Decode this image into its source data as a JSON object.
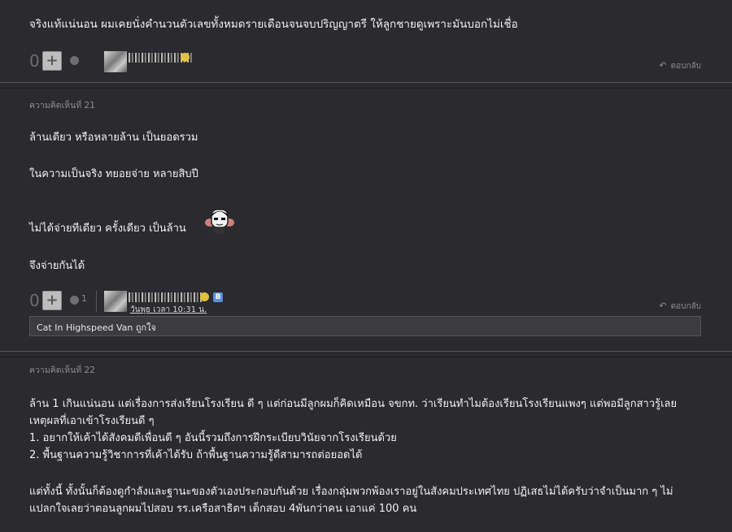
{
  "comment20": {
    "text": "จริงแท้แน่นอน   ผมเคยนั่งคำนวนตัวเลขทั้งหมดรายเดือนจนจบปริญญาตรี   ให้ลูกชายดูเพราะมันบอกไม่เชื่อ",
    "score": "0",
    "plus_label": "+",
    "reply_label": "ตอบกลับ"
  },
  "comment21": {
    "label": "ความคิดเห็นที่ 21",
    "lines": [
      "ล้านเดียว หรือหลายล้าน  เป็นยอดรวม",
      "ในความเป็นจริง ทยอยจ่าย  หลายสิบปี",
      "ไม่ได้จ่ายทีเดียว  ครั้งเดียว  เป็นล้าน",
      "จึงจ่ายกันได้"
    ],
    "score": "0",
    "plus_label": "+",
    "emotion_count": "1",
    "date": "วันพุธ เวลา 10:31 น.",
    "badge": "B",
    "reply_label": "ตอบกลับ",
    "quote": "Cat In Highspeed Van ถูกใจ"
  },
  "comment22": {
    "label": "ความคิดเห็นที่ 22",
    "lines": [
      "ล้าน 1 เกินแน่นอน แต่เรื่องการส่งเรียนโรงเรียน ดี ๆ แต่ก่อนมีลูกผมก็คิดเหมือน จขกท. ว่าเรียนทำไมต้องเรียนโรงเรียนแพงๆ แต่พอมีลูกสาวรู้เลย",
      "เหตุผลที่เอาเข้าโรงเรียนดี ๆ",
      "1. อยากให้เค้าได้สังคมดีเพื่อนดี ๆ อันนี้รวมถึงการฝึกระเบียบวินัยจากโรงเรียนด้วย",
      "2. พื้นฐานความรู้วิชาการที่เค้าได้รับ ถ้าพื้นฐานความรู้ดีสามารถต่อยอดได้",
      "แต่ทั้งนี้ ทั้งนั้นก็ต้องดูกำลังและฐานะของตัวเองประกอบกันด้วย  เรื่องกลุ่มพวกพ้องเราอยู่ในสังคมประเทศไทย ปฏิเสธไม่ได้ครับว่าจำเป็นมาก ๆ ไม่",
      "แปลกใจเลยว่าตอนลูกผมไปสอบ รร.เครือสาธิตฯ เด็กสอบ 4พันกว่าคน เอาแค่ 100 คน"
    ]
  },
  "colors": {
    "background": "#2b2a2f",
    "text": "#f0f0f0",
    "muted": "#8c8c90",
    "quote_bg": "#3c3b40"
  }
}
